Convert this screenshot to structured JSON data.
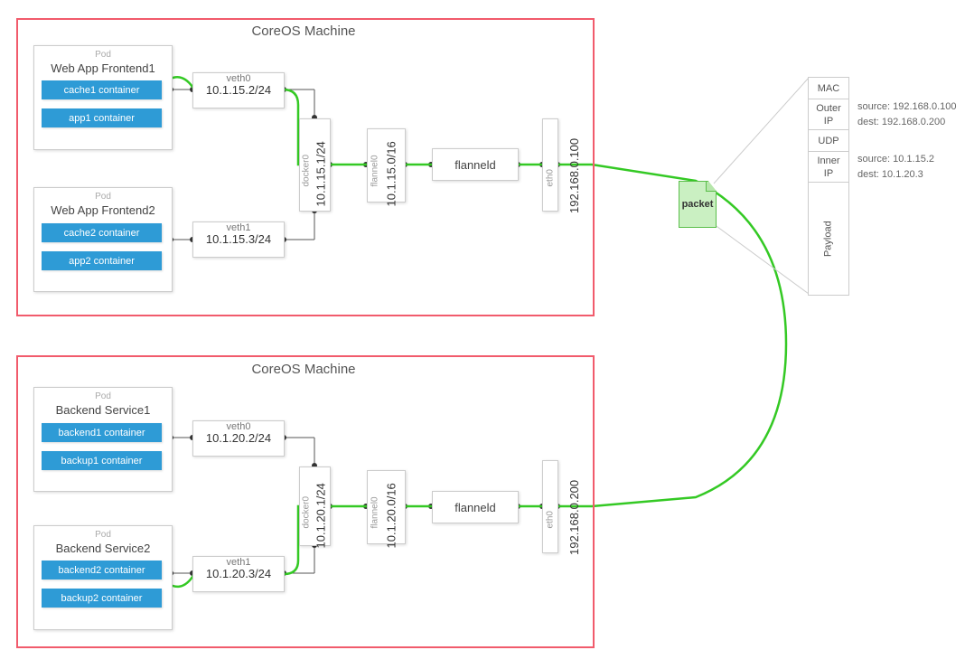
{
  "machine_title": "CoreOS Machine",
  "pod_label": "Pod",
  "packet_label": "packet",
  "m1": {
    "pod1": {
      "name": "Web App Frontend1",
      "c1": "cache1 container",
      "c2": "app1 container"
    },
    "pod2": {
      "name": "Web App Frontend2",
      "c1": "cache2 container",
      "c2": "app2 container"
    },
    "veth0": {
      "label": "veth0",
      "ip": "10.1.15.2/24"
    },
    "veth1": {
      "label": "veth1",
      "ip": "10.1.15.3/24"
    },
    "docker0": {
      "label": "docker0",
      "ip": "10.1.15.1/24"
    },
    "flannel0": {
      "label": "flannel0",
      "ip": "10.1.15.0/16"
    },
    "flanneld": "flanneld",
    "eth0": {
      "label": "eth0",
      "ip": "192.168.0.100"
    }
  },
  "m2": {
    "pod1": {
      "name": "Backend Service1",
      "c1": "backend1 container",
      "c2": "backup1 container"
    },
    "pod2": {
      "name": "Backend Service2",
      "c1": "backend2 container",
      "c2": "backup2 container"
    },
    "veth0": {
      "label": "veth0",
      "ip": "10.1.20.2/24"
    },
    "veth1": {
      "label": "veth1",
      "ip": "10.1.20.3/24"
    },
    "docker0": {
      "label": "docker0",
      "ip": "10.1.20.1/24"
    },
    "flannel0": {
      "label": "flannel0",
      "ip": "10.1.20.0/16"
    },
    "flanneld": "flanneld",
    "eth0": {
      "label": "eth0",
      "ip": "192.168.0.200"
    }
  },
  "packet_table": {
    "mac": "MAC",
    "outer_ip": "Outer\nIP",
    "outer_src": "source: 192.168.0.100",
    "outer_dst": "dest: 192.168.0.200",
    "udp": "UDP",
    "inner_ip": "Inner\nIP",
    "inner_src": "source: 10.1.15.2",
    "inner_dst": "dest: 10.1.20.3",
    "payload": "Payload"
  }
}
